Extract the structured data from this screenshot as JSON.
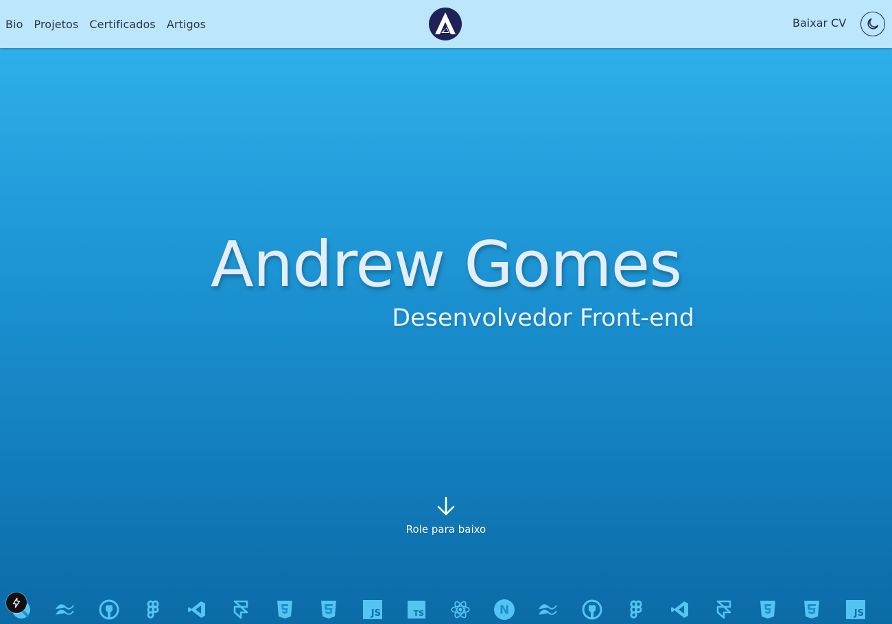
{
  "nav": {
    "links": [
      "Bio",
      "Projetos",
      "Certificados",
      "Artigos"
    ],
    "cv_label": "Baixar CV",
    "logo_icon": "brand-a-logo-icon",
    "theme_icon": "moon-icon"
  },
  "hero": {
    "title": "Andrew Gomes",
    "subtitle": "Desenvolvedor Front-end",
    "scroll_label": "Role para baixo",
    "scroll_icon": "arrow-down-icon"
  },
  "tech_icons": [
    "jest-icon",
    "tailwind-icon",
    "github-icon",
    "figma-icon",
    "vscode-icon",
    "framer-icon",
    "html5-icon",
    "css3-icon",
    "javascript-icon",
    "typescript-icon",
    "react-icon",
    "nextjs-icon",
    "tailwind-icon",
    "github-icon",
    "figma-icon",
    "vscode-icon",
    "framer-icon",
    "html5-icon",
    "css3-icon",
    "javascript-icon"
  ],
  "badges": {
    "js": "JS",
    "ts": "TS",
    "next": "N"
  },
  "colors": {
    "header_bg": "#bbe6fb",
    "hero_top": "#2eb0ea",
    "hero_bottom": "#0b6ba7",
    "logo": "#1f2257",
    "icon": "#55c4f3"
  }
}
